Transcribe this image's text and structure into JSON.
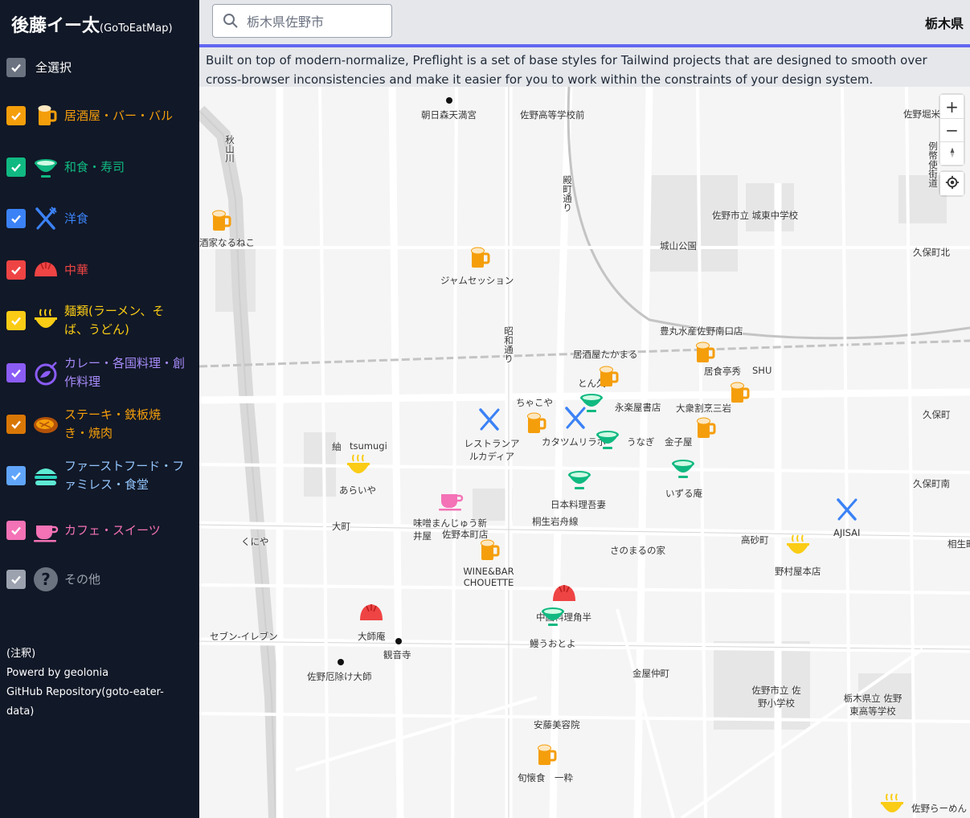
{
  "sidebar": {
    "title_main": "後藤イー太",
    "title_sub": "(GoToEatMap)",
    "select_all": "全選択",
    "categories": [
      {
        "label": "居酒屋・バー・バル",
        "color": "#f59e0b",
        "icon": "beer-mug-icon"
      },
      {
        "label": "和食・寿司",
        "color": "#10b981",
        "icon": "rice-bowl-icon"
      },
      {
        "label": "洋食",
        "color": "#3b82f6",
        "icon": "fork-knife-icon"
      },
      {
        "label": "中華",
        "color": "#ef4444",
        "icon": "dumpling-icon"
      },
      {
        "label": "麺類(ラーメン、そば、うどん)",
        "color": "#facc15",
        "icon": "noodle-bowl-icon"
      },
      {
        "label": "カレー・各国料理・創作料理",
        "color": "#8b5cf6",
        "icon": "curry-plate-icon"
      },
      {
        "label": "ステーキ・鉄板焼き・焼肉",
        "color": "#d97706",
        "icon": "steak-icon"
      },
      {
        "label": "ファーストフード・ファミレス・食堂",
        "color": "#60a5fa",
        "icon": "burger-icon"
      },
      {
        "label": "カフェ・スイーツ",
        "color": "#f472b6",
        "icon": "coffee-cup-icon"
      },
      {
        "label": "その他",
        "color": "#9ca3af",
        "icon": "question-icon"
      }
    ],
    "notes": [
      "(注釈)",
      "Powerd by geolonia",
      "GitHub Repository(goto-eater-data)"
    ]
  },
  "search": {
    "value": "栃木県佐野市"
  },
  "prefecture": "栃木県",
  "banner": "Built on top of modern-normalize, Preflight is a set of base styles for Tailwind projects that are designed to smooth over cross-browser inconsistencies and make it easier for you to work within the constraints of your design system.",
  "map": {
    "labels": [
      "朝日森天満宮",
      "佐野高等学校前",
      "佐野堀米",
      "殿町通り",
      "佐野市立 城東中学校",
      "城山公園",
      "久保町北",
      "酒家なるねこ",
      "ジャムセッション",
      "昭和通り",
      "豊丸水産佐野南口店",
      "居酒屋たかまる",
      "居食亭秀",
      "SHU",
      "とん久",
      "ちゃこや",
      "永楽屋書店",
      "大衆割烹三岩",
      "久保町",
      "レストランアルカディア",
      "カタツムリラボ",
      "うなぎ",
      "金子屋",
      "紬",
      "tsumugi",
      "あらいや",
      "日本料理吾妻",
      "いずる庵",
      "久保町南",
      "大町",
      "味噌まんじゅう新井屋",
      "佐野本町店",
      "桐生岩舟線",
      "くにや",
      "さのまるの家",
      "高砂町",
      "AJISAI",
      "相生町",
      "WINE&BAR CHOUETTE",
      "野村屋本店",
      "中国料理角半",
      "大師庵",
      "観音寺",
      "鰻うおとよ",
      "セブン-イレブン",
      "佐野厄除け大師",
      "金屋仲町",
      "佐野市立 佐野小学校",
      "栃木県立 佐野東高等学校",
      "安藤美容院",
      "旬懐食",
      "一粋",
      "佐野らーめん",
      "秋山川",
      "例幣使街道"
    ],
    "zoom_in": "+",
    "zoom_out": "−"
  }
}
